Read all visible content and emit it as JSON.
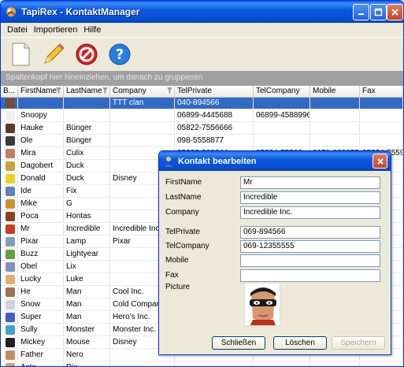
{
  "window": {
    "title": "TapiRex - KontaktManager"
  },
  "menu": [
    "Datei",
    "Importieren",
    "Hilfe"
  ],
  "toolbar": {
    "icons": [
      "new-document-icon",
      "edit-pencil-icon",
      "delete-icon",
      "help-icon"
    ]
  },
  "group_panel": "Spaltenkopf hier hineinziehen, um danach zu gruppieren",
  "columns": [
    "B...",
    "FirstName",
    "LastName",
    "Company",
    "TelPrivate",
    "TelCompany",
    "Mobile",
    "Fax"
  ],
  "rows": [
    [
      "",
      "",
      "",
      "TTT clan",
      "040-894566",
      "",
      "",
      ""
    ],
    [
      "",
      "Snoopy",
      "",
      "",
      "06899-4445688",
      "06899-4588996",
      "",
      ""
    ],
    [
      "",
      "Hauke",
      "Bünger",
      "",
      "05822-7556666",
      "",
      "",
      ""
    ],
    [
      "",
      "Ole",
      "Bünger",
      "",
      "098-5558877",
      "",
      "",
      ""
    ],
    [
      "",
      "Mira",
      "Culix",
      "",
      "05233-888844",
      "05234-75588",
      "0171-9888555",
      "05234-75599"
    ],
    [
      "",
      "Dagobert",
      "Duck",
      "",
      "",
      "",
      "",
      ""
    ],
    [
      "",
      "Donald",
      "Duck",
      "Disney",
      "",
      "",
      "",
      ""
    ],
    [
      "",
      "Ide",
      "Fix",
      "",
      "",
      "",
      "",
      ""
    ],
    [
      "",
      "Mike",
      "G",
      "",
      "",
      "",
      "",
      ""
    ],
    [
      "",
      "Poca",
      "Hontas",
      "",
      "",
      "",
      "",
      ""
    ],
    [
      "",
      "Mr",
      "Incredible",
      "Incredible Inc.",
      "",
      "",
      "",
      ""
    ],
    [
      "",
      "Pixar",
      "Lamp",
      "Pixar",
      "",
      "",
      "",
      ""
    ],
    [
      "",
      "Buzz",
      "Lightyear",
      "",
      "",
      "",
      "",
      ""
    ],
    [
      "",
      "Obel",
      "Lix",
      "",
      "",
      "",
      "",
      ""
    ],
    [
      "",
      "Lucky",
      "Luke",
      "",
      "",
      "",
      "",
      ""
    ],
    [
      "",
      "He",
      "Man",
      "Cool Inc.",
      "",
      "",
      "",
      ""
    ],
    [
      "",
      "Snow",
      "Man",
      "Cold Company",
      "",
      "",
      "",
      ""
    ],
    [
      "",
      "Super",
      "Man",
      "Hero's Inc.",
      "",
      "",
      "",
      ""
    ],
    [
      "",
      "Sully",
      "Monster",
      "Monster Inc.",
      "",
      "",
      "",
      ""
    ],
    [
      "",
      "Mickey",
      "Mouse",
      "Disney",
      "",
      "",
      "",
      ""
    ],
    [
      "",
      "Father",
      "Nero",
      "",
      "",
      "",
      "",
      ""
    ],
    [
      "",
      "Aste",
      "Rix",
      "",
      "",
      "",
      "",
      ""
    ]
  ],
  "avatar_colors": [
    "#7a4a2a",
    "#f0f0f0",
    "#5a3a2a",
    "#3a3a3a",
    "#c08060",
    "#d0a040",
    "#f0d020",
    "#6080c0",
    "#d09030",
    "#904020",
    "#c04020",
    "#80a0c0",
    "#60a040",
    "#8090c0",
    "#e0b070",
    "#a07050",
    "#d0d0e0",
    "#4060c0",
    "#40a0d0",
    "#202020",
    "#c09060",
    "#d0a060"
  ],
  "dialog": {
    "title": "Kontakt bearbeiten",
    "fields": [
      {
        "label": "FirstName",
        "value": "Mr"
      },
      {
        "label": "LastName",
        "value": "Incredible"
      },
      {
        "label": "Company",
        "value": "Incredible Inc."
      },
      {
        "label": "TelPrivate",
        "value": "069-894566"
      },
      {
        "label": "TelCompany",
        "value": "069-12355555"
      },
      {
        "label": "Mobile",
        "value": ""
      },
      {
        "label": "Fax",
        "value": ""
      }
    ],
    "picture_label": "Picture",
    "buttons": {
      "close": "Schließen",
      "delete": "Löschen",
      "save": "Speichern"
    }
  }
}
